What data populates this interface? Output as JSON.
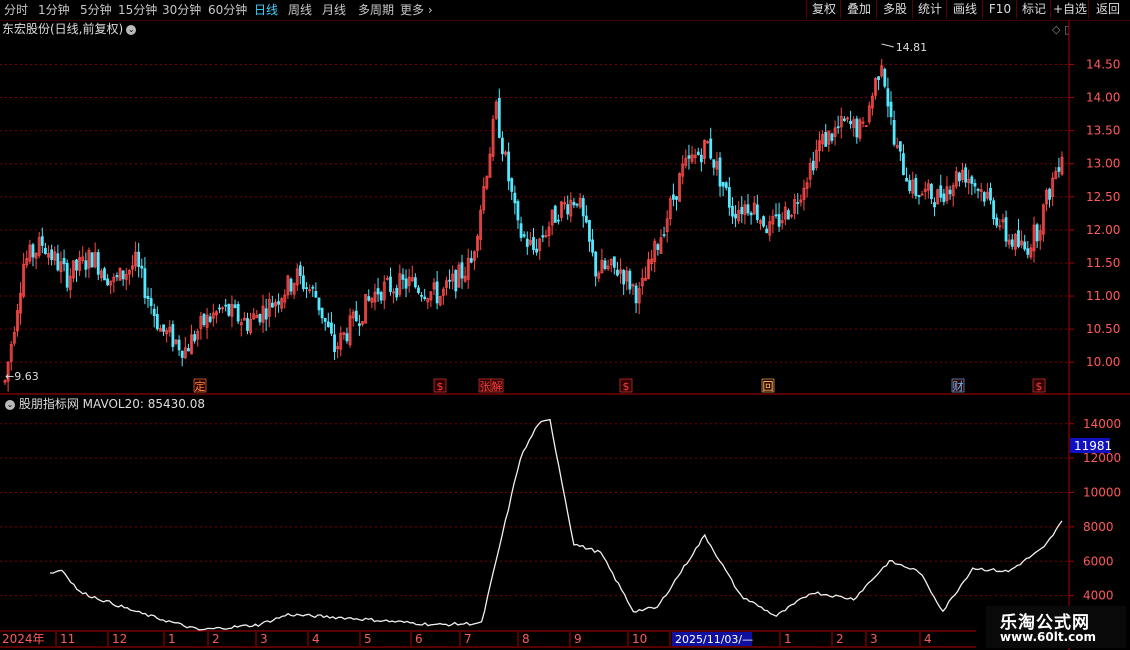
{
  "toolbar": {
    "periods": [
      "分时",
      "1分钟",
      "5分钟",
      "15分钟",
      "30分钟",
      "60分钟",
      "日线",
      "周线",
      "月线",
      "多周期",
      "更多"
    ],
    "active_period": "日线",
    "right_buttons": [
      "复权",
      "叠加",
      "多股",
      "统计",
      "画线",
      "F10",
      "标记",
      "+自选",
      "返回"
    ]
  },
  "stock": {
    "title": "东宏股份(日线,前复权)",
    "high_label": "14.81",
    "low_label": "9.63"
  },
  "price_axis": [
    "14.50",
    "14.00",
    "13.50",
    "13.00",
    "12.50",
    "12.00",
    "11.50",
    "11.00",
    "10.50",
    "10.00"
  ],
  "markers": [
    {
      "text": "定",
      "color": "#ff8a3c"
    },
    {
      "text": "$",
      "color": "#ff4040"
    },
    {
      "text": "张",
      "color": "#ff4040"
    },
    {
      "text": "解",
      "color": "#ff4040"
    },
    {
      "text": "$",
      "color": "#ff4040"
    },
    {
      "text": "回",
      "color": "#ffcc66"
    },
    {
      "text": "财",
      "color": "#6fc0ff"
    },
    {
      "text": "$",
      "color": "#ff4040"
    }
  ],
  "indicator": {
    "name": "股朋指标网",
    "label": "MAVOL20: 85430.08",
    "axis": [
      "14000",
      "12000",
      "10000",
      "8000",
      "6000",
      "4000"
    ],
    "current_tag": "11981"
  },
  "date_axis": {
    "year": "2024年",
    "months": [
      "11",
      "12",
      "1",
      "2",
      "3",
      "4",
      "5",
      "6",
      "7",
      "8",
      "9",
      "10",
      "2025/11/03/—",
      "1",
      "2",
      "3",
      "4"
    ]
  },
  "watermark": {
    "line1": "乐淘公式网",
    "line2": "www.60lt.com"
  },
  "colors": {
    "up": "#ff4a4a",
    "down": "#54e8ff",
    "grid": "#7a0000",
    "frame": "#b00000",
    "axis_text": "#ff5a5a"
  },
  "chart_data": {
    "type": "candlestick",
    "price_anchors": [
      [
        0,
        9.7
      ],
      [
        6,
        11.5
      ],
      [
        12,
        11.8
      ],
      [
        20,
        11.3
      ],
      [
        28,
        11.6
      ],
      [
        35,
        11.2
      ],
      [
        42,
        11.5
      ],
      [
        50,
        10.5
      ],
      [
        58,
        10.2
      ],
      [
        64,
        10.6
      ],
      [
        70,
        10.8
      ],
      [
        78,
        10.6
      ],
      [
        86,
        10.9
      ],
      [
        94,
        11.3
      ],
      [
        100,
        11.0
      ],
      [
        106,
        10.2
      ],
      [
        112,
        10.6
      ],
      [
        120,
        11.1
      ],
      [
        130,
        11.2
      ],
      [
        140,
        11.0
      ],
      [
        150,
        11.5
      ],
      [
        158,
        13.8
      ],
      [
        165,
        12.0
      ],
      [
        170,
        11.7
      ],
      [
        178,
        12.3
      ],
      [
        184,
        12.5
      ],
      [
        190,
        11.4
      ],
      [
        198,
        11.4
      ],
      [
        204,
        11.0
      ],
      [
        210,
        11.8
      ],
      [
        218,
        12.9
      ],
      [
        226,
        13.3
      ],
      [
        234,
        12.3
      ],
      [
        240,
        12.4
      ],
      [
        246,
        12.0
      ],
      [
        254,
        12.4
      ],
      [
        262,
        13.3
      ],
      [
        270,
        13.6
      ],
      [
        276,
        13.5
      ],
      [
        282,
        14.6
      ],
      [
        286,
        13.3
      ],
      [
        292,
        12.6
      ],
      [
        300,
        12.5
      ],
      [
        308,
        12.9
      ],
      [
        316,
        12.5
      ],
      [
        322,
        11.9
      ],
      [
        328,
        11.7
      ],
      [
        332,
        12.0
      ],
      [
        336,
        12.6
      ],
      [
        340,
        13.2
      ]
    ],
    "mavol_anchors": [
      [
        0,
        5300
      ],
      [
        4,
        5500
      ],
      [
        10,
        4200
      ],
      [
        30,
        3000
      ],
      [
        50,
        2000
      ],
      [
        70,
        2300
      ],
      [
        80,
        2900
      ],
      [
        100,
        2700
      ],
      [
        130,
        2300
      ],
      [
        145,
        2400
      ],
      [
        158,
        12000
      ],
      [
        164,
        14000
      ],
      [
        168,
        14200
      ],
      [
        176,
        7000
      ],
      [
        185,
        6500
      ],
      [
        196,
        3100
      ],
      [
        204,
        3300
      ],
      [
        220,
        7500
      ],
      [
        232,
        4000
      ],
      [
        244,
        2800
      ],
      [
        256,
        4200
      ],
      [
        270,
        3800
      ],
      [
        282,
        6000
      ],
      [
        292,
        5400
      ],
      [
        300,
        3100
      ],
      [
        310,
        5600
      ],
      [
        322,
        5400
      ],
      [
        334,
        6800
      ],
      [
        340,
        8300
      ]
    ],
    "y_range_price": [
      9.55,
      14.9
    ],
    "y_range_mavol": [
      2000,
      14800
    ]
  }
}
